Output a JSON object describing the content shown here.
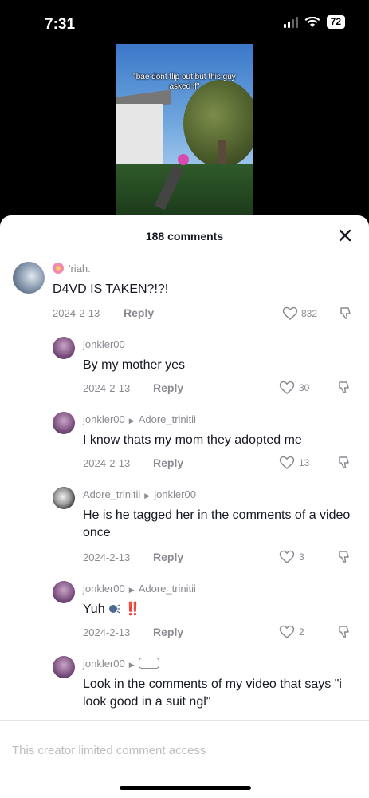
{
  "status": {
    "time": "7:31",
    "battery": "72"
  },
  "video": {
    "caption": "\"bae dont flip out but this guy asked if\""
  },
  "sheet": {
    "title": "188 comments"
  },
  "comments": [
    {
      "username": "'riah.",
      "text": "D4VD IS TAKEN?!?!",
      "date": "2024-2-13",
      "reply": "Reply",
      "likes": "832"
    },
    {
      "username": "jonkler00",
      "text": "By my mother yes",
      "date": "2024-2-13",
      "reply": "Reply",
      "likes": "30"
    },
    {
      "username": "jonkler00",
      "reply_to": "Adore_trinitii",
      "text": "I know thats my mom they adopted me",
      "date": "2024-2-13",
      "reply": "Reply",
      "likes": "13"
    },
    {
      "username": "Adore_trinitii",
      "reply_to": "jonkler00",
      "text": "He is he tagged her in the comments of a video once",
      "date": "2024-2-13",
      "reply": "Reply",
      "likes": "3"
    },
    {
      "username": "jonkler00",
      "reply_to": "Adore_trinitii",
      "text": "Yuh",
      "text_suffix": "‼️",
      "date": "2024-2-13",
      "reply": "Reply",
      "likes": "2"
    },
    {
      "username": "jonkler00",
      "text": "Look in the comments of my video that says \"i look good in a suit ngl\""
    }
  ],
  "footer": {
    "text": "This creator limited comment access"
  },
  "colors": {
    "meta": "#8a8b91",
    "text": "#161823",
    "accent": "#e0262a"
  }
}
